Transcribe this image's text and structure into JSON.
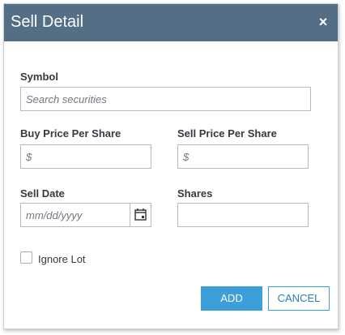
{
  "dialog": {
    "title": "Sell Detail",
    "close_glyph": "×"
  },
  "symbol": {
    "label": "Symbol",
    "placeholder": "Search securities"
  },
  "buy_price": {
    "label": "Buy Price Per Share",
    "placeholder": "$"
  },
  "sell_price": {
    "label": "Sell Price Per Share",
    "placeholder": "$"
  },
  "sell_date": {
    "label": "Sell Date",
    "placeholder": "mm/dd/yyyy",
    "calendar_icon": "calendar-icon"
  },
  "shares": {
    "label": "Shares",
    "placeholder": ""
  },
  "ignore_lot": {
    "label": "Ignore Lot",
    "checked": false
  },
  "buttons": {
    "add_label": "ADD",
    "cancel_label": "CANCEL"
  },
  "colors": {
    "titlebar": "#546e86",
    "primary": "#3d9fd9"
  }
}
